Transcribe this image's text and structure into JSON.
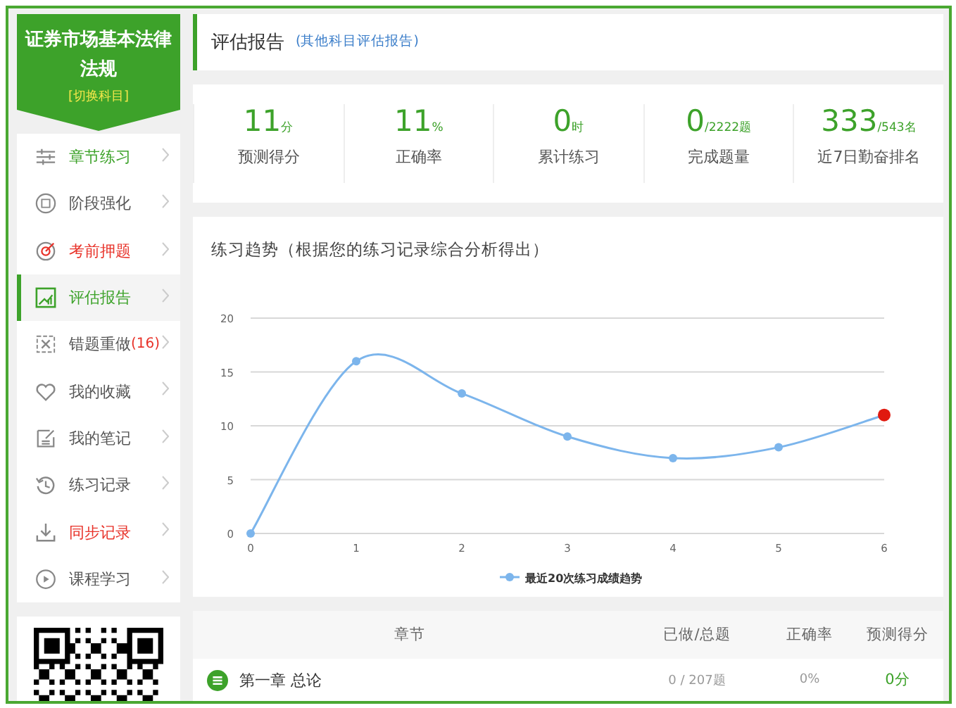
{
  "sidebar": {
    "subject": "证券市场基本法律法规",
    "switch_link": "[切换科目]",
    "items": [
      {
        "label": "章节练习",
        "selected": false,
        "color": "#3da22a"
      },
      {
        "label": "阶段强化",
        "selected": false,
        "color": "#555555"
      },
      {
        "label": "考前押题",
        "selected": false,
        "color": "#e8332a"
      },
      {
        "label": "评估报告",
        "selected": true,
        "color": "#3da22a"
      },
      {
        "label": "错题重做",
        "selected": false,
        "color": "#555555",
        "count": "(16)"
      },
      {
        "label": "我的收藏",
        "selected": false,
        "color": "#555555"
      },
      {
        "label": "我的笔记",
        "selected": false,
        "color": "#555555"
      },
      {
        "label": "练习记录",
        "selected": false,
        "color": "#555555"
      },
      {
        "label": "同步记录",
        "selected": false,
        "color": "#e8332a"
      },
      {
        "label": "课程学习",
        "selected": false,
        "color": "#555555"
      }
    ]
  },
  "header": {
    "title": "评估报告",
    "link": "(其他科目评估报告)"
  },
  "stats": [
    {
      "value": "11",
      "unit": "分",
      "label": "预测得分"
    },
    {
      "value": "11",
      "unit": "%",
      "label": "正确率"
    },
    {
      "value": "0",
      "unit": "时",
      "label": "累计练习"
    },
    {
      "value": "0",
      "unit": "/2222题",
      "label": "完成题量"
    },
    {
      "value": "333",
      "unit": "/543名",
      "label": "近7日勤奋排名"
    }
  ],
  "trend": {
    "latest_marker": {
      "color": "#e0190f"
    },
    "chart_data": {
      "type": "line",
      "title": "练习趋势（根据您的练习记录综合分析得出）",
      "x": [
        0,
        1,
        2,
        3,
        4,
        5,
        6
      ],
      "xlim": [
        0,
        6
      ],
      "ylim": [
        0,
        20
      ],
      "xticks": [
        0,
        1,
        2,
        3,
        4,
        5,
        6
      ],
      "yticks": [
        0,
        5,
        10,
        15,
        20
      ],
      "grid": true,
      "series": [
        {
          "name": "最近20次练习成绩趋势",
          "color": "#7cb5ec",
          "marker": "circle",
          "values": [
            0,
            16,
            13,
            9,
            7,
            8,
            11
          ]
        }
      ]
    }
  },
  "table": {
    "columns": [
      "章节",
      "已做/总题",
      "正确率",
      "预测得分"
    ],
    "rows": [
      {
        "chapter": "第一章 总论",
        "done": "0 / 207题",
        "accuracy": "0%",
        "score": "0分"
      }
    ]
  }
}
